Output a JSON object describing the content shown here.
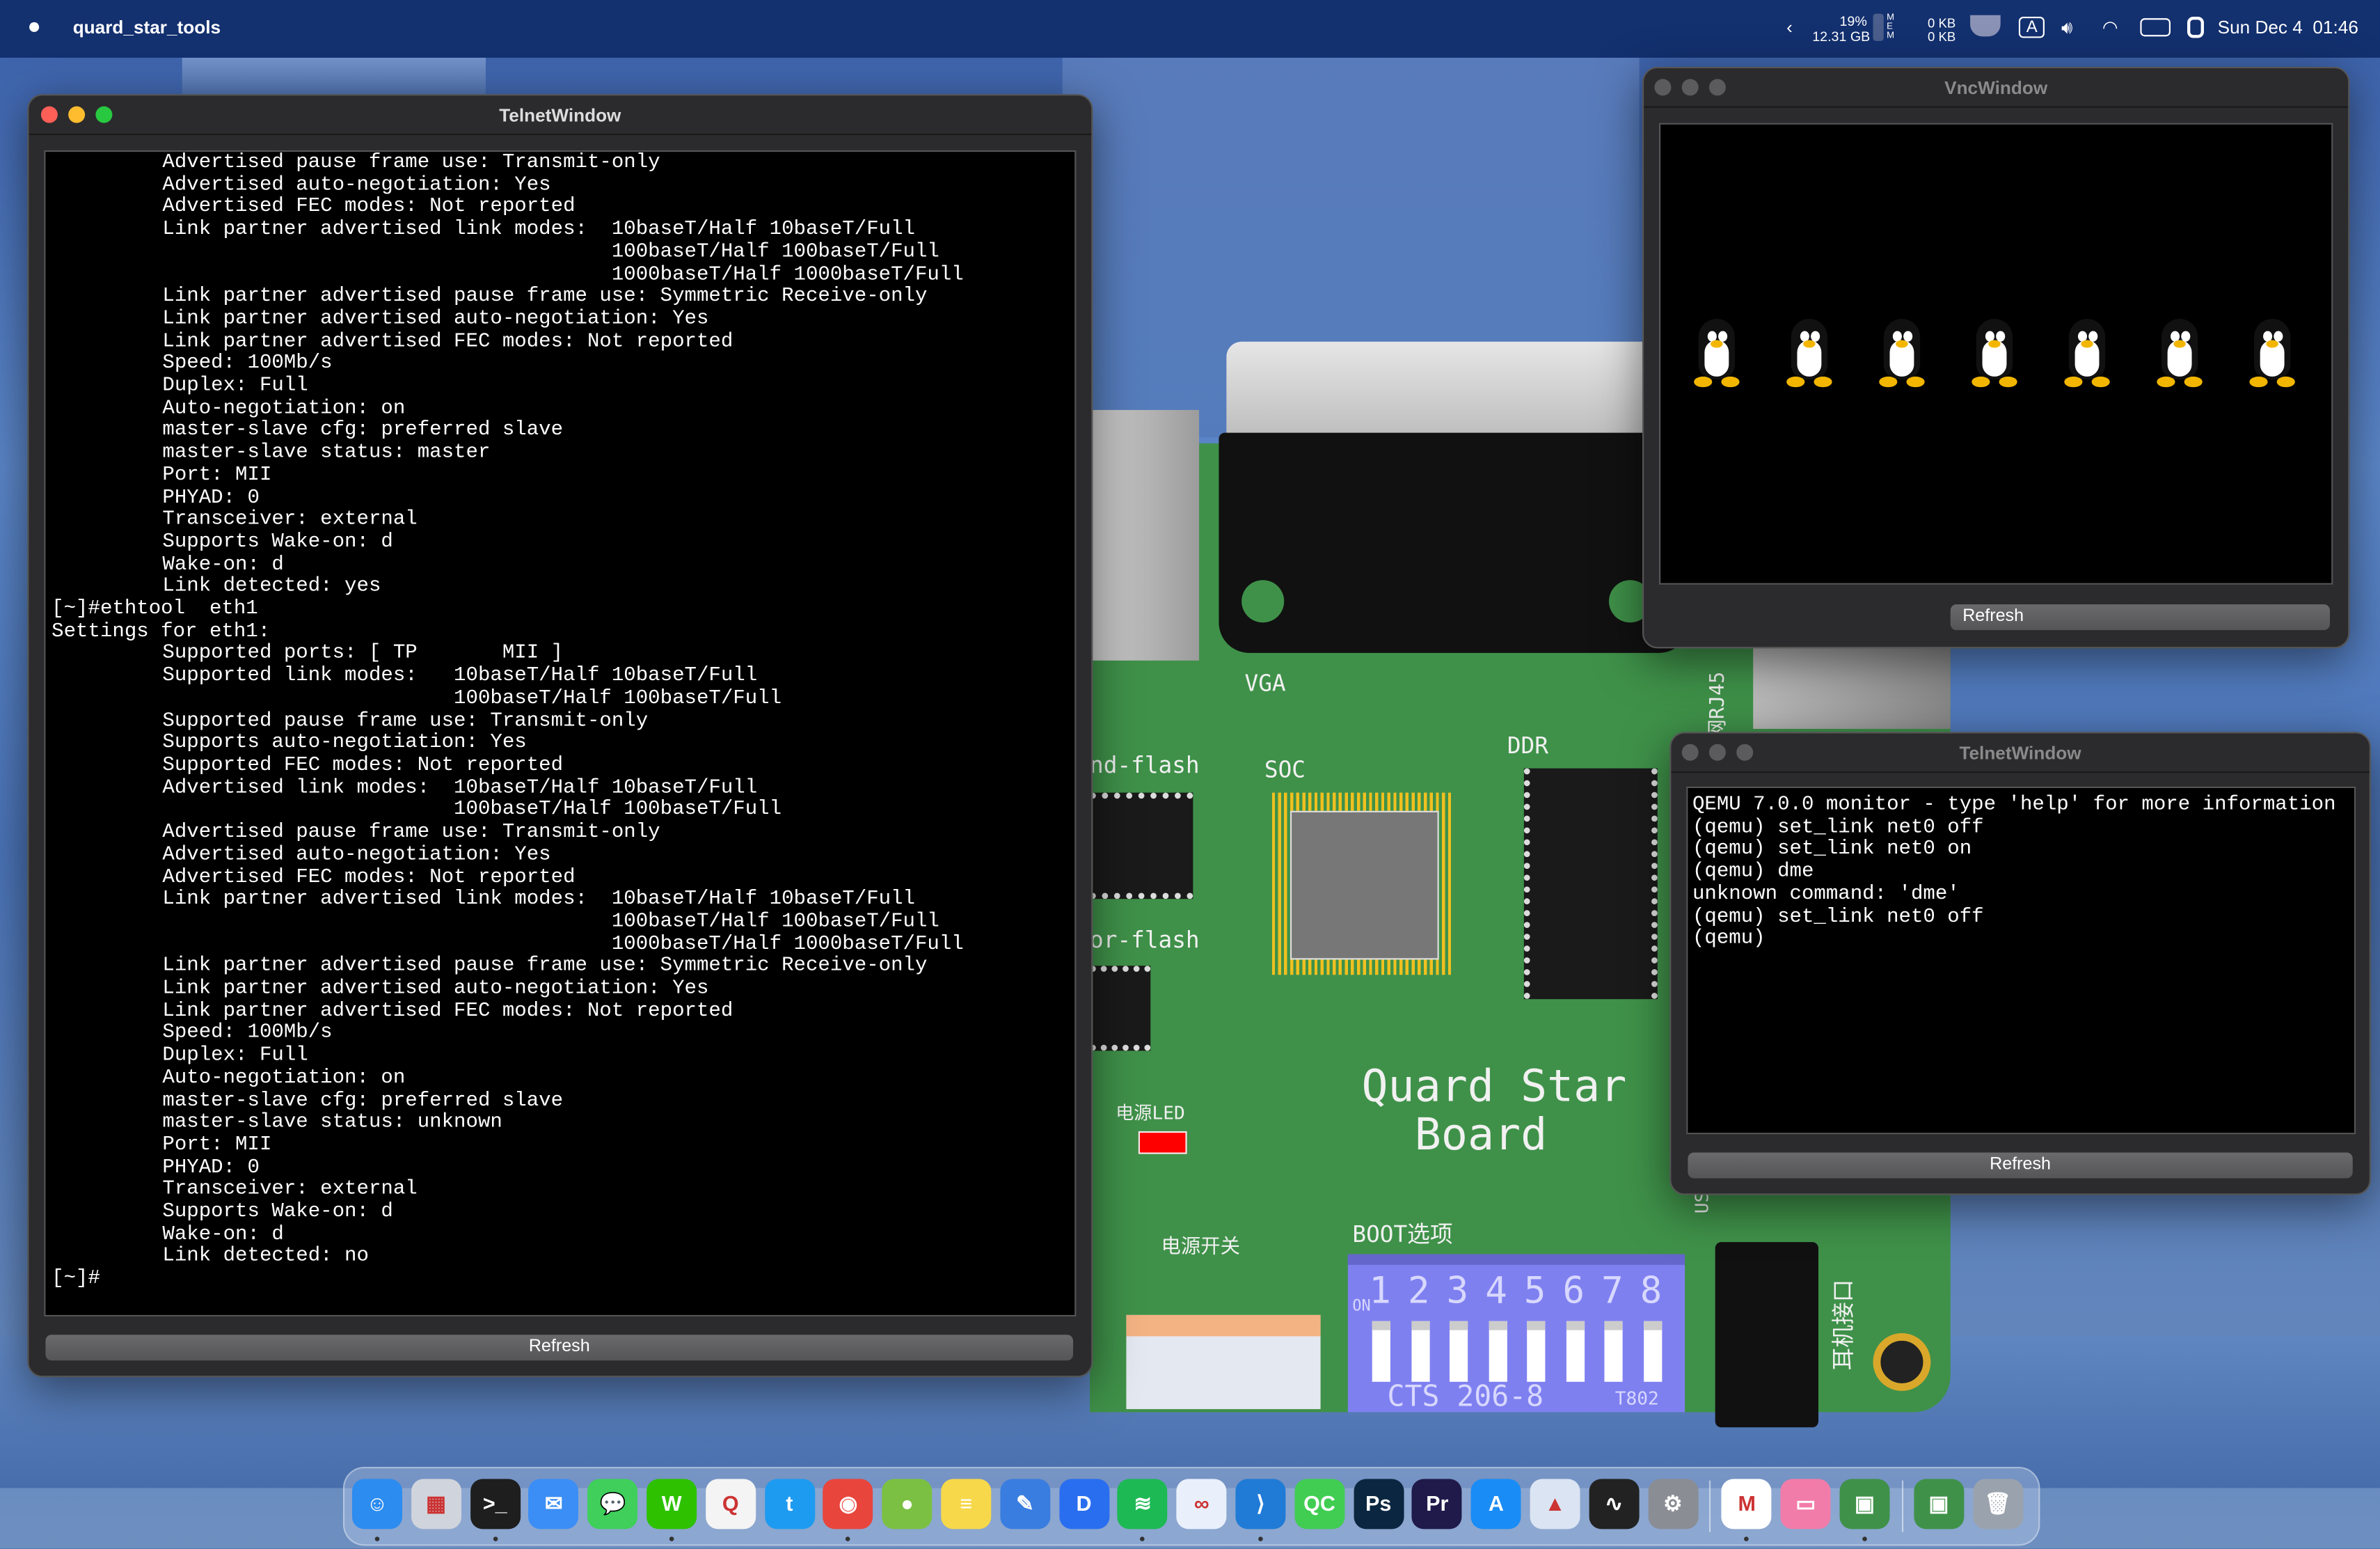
{
  "menubar": {
    "app_name": "quard_star_tools",
    "cpu_percent": "19%",
    "mem_used": "12.31 GB",
    "mem_label": "MEM",
    "net_up": "0 KB",
    "net_down": "0 KB",
    "input_source": "A",
    "datetime": "Sun Dec 4  01:46"
  },
  "left_telnet": {
    "title": "TelnetWindow",
    "refresh_label": "Refresh",
    "lines": [
      "\tAdvertised pause frame use: Transmit-only",
      "\tAdvertised auto-negotiation: Yes",
      "\tAdvertised FEC modes: Not reported",
      "\tLink partner advertised link modes:  10baseT/Half 10baseT/Full",
      "\t                                     100baseT/Half 100baseT/Full",
      "\t                                     1000baseT/Half 1000baseT/Full",
      "\tLink partner advertised pause frame use: Symmetric Receive-only",
      "\tLink partner advertised auto-negotiation: Yes",
      "\tLink partner advertised FEC modes: Not reported",
      "\tSpeed: 100Mb/s",
      "\tDuplex: Full",
      "\tAuto-negotiation: on",
      "\tmaster-slave cfg: preferred slave",
      "\tmaster-slave status: master",
      "\tPort: MII",
      "\tPHYAD: 0",
      "\tTransceiver: external",
      "\tSupports Wake-on: d",
      "\tWake-on: d",
      "\tLink detected: yes",
      "[~]#ethtool  eth1",
      "Settings for eth1:",
      "\tSupported ports: [ TP       MII ]",
      "\tSupported link modes:   10baseT/Half 10baseT/Full",
      "\t                        100baseT/Half 100baseT/Full",
      "\tSupported pause frame use: Transmit-only",
      "\tSupports auto-negotiation: Yes",
      "\tSupported FEC modes: Not reported",
      "\tAdvertised link modes:  10baseT/Half 10baseT/Full",
      "\t                        100baseT/Half 100baseT/Full",
      "\tAdvertised pause frame use: Transmit-only",
      "\tAdvertised auto-negotiation: Yes",
      "\tAdvertised FEC modes: Not reported",
      "\tLink partner advertised link modes:  10baseT/Half 10baseT/Full",
      "\t                                     100baseT/Half 100baseT/Full",
      "\t                                     1000baseT/Half 1000baseT/Full",
      "\tLink partner advertised pause frame use: Symmetric Receive-only",
      "\tLink partner advertised auto-negotiation: Yes",
      "\tLink partner advertised FEC modes: Not reported",
      "\tSpeed: 100Mb/s",
      "\tDuplex: Full",
      "\tAuto-negotiation: on",
      "\tmaster-slave cfg: preferred slave",
      "\tmaster-slave status: unknown",
      "\tPort: MII",
      "\tPHYAD: 0",
      "\tTransceiver: external",
      "\tSupports Wake-on: d",
      "\tWake-on: d",
      "\tLink detected: no",
      "[~]#"
    ]
  },
  "vnc": {
    "title": "VncWindow",
    "refresh_label": "Refresh",
    "penguin_count": 7
  },
  "right_telnet": {
    "title": "TelnetWindow",
    "refresh_label": "Refresh",
    "lines": [
      "QEMU 7.0.0 monitor - type 'help' for more information",
      "(qemu) set_link net0 off",
      "(qemu) set_link net0 on",
      "(qemu) dme",
      "unknown command: 'dme'",
      "(qemu) set_link net0 off",
      "(qemu)"
    ]
  },
  "board": {
    "vga": "VGA",
    "rj45": "网RJ45",
    "nand": "nd-flash",
    "nor": "or-flash",
    "soc": "SOC",
    "ddr": "DDR",
    "led": "电源LED",
    "title_line1": "Quard Star",
    "title_line2": "Board",
    "power_switch": "电源开关",
    "boot": "BOOT选项",
    "dip_numbers": [
      "1",
      "2",
      "3",
      "4",
      "5",
      "6",
      "7",
      "8"
    ],
    "dip_on": "ON",
    "dip_model": "CTS 206-8",
    "dip_code": "T802",
    "earphone": "耳机接口",
    "usb": "US",
    "led_color": "#ff0000",
    "pcb_color": "#3f9149",
    "dip_color": "#7f80f0"
  },
  "dock": {
    "items": [
      {
        "name": "finder",
        "label": "☺",
        "color": "#2d8cf0",
        "running": true
      },
      {
        "name": "launchpad",
        "label": "▦",
        "color": "#d0d4dc",
        "running": false
      },
      {
        "name": "terminal",
        "label": ">_",
        "color": "#1e1e1e",
        "running": true
      },
      {
        "name": "mail",
        "label": "✉",
        "color": "#3b8ef5",
        "running": false
      },
      {
        "name": "messages",
        "label": "💬",
        "color": "#3fcf5a",
        "running": false
      },
      {
        "name": "wechat",
        "label": "W",
        "color": "#2dc100",
        "running": true
      },
      {
        "name": "qq",
        "label": "Q",
        "color": "#f4f4f4",
        "running": false
      },
      {
        "name": "twitter",
        "label": "t",
        "color": "#1d9bf0",
        "running": false
      },
      {
        "name": "chrome",
        "label": "◉",
        "color": "#e8453c",
        "running": true
      },
      {
        "name": "game",
        "label": "●",
        "color": "#7bc043",
        "running": false
      },
      {
        "name": "notes",
        "label": "≡",
        "color": "#f7d84a",
        "running": false
      },
      {
        "name": "pencil",
        "label": "✎",
        "color": "#3a7de0",
        "running": false
      },
      {
        "name": "dict",
        "label": "D",
        "color": "#2a6ef0",
        "running": false
      },
      {
        "name": "spotify",
        "label": "≋",
        "color": "#1db954",
        "running": true
      },
      {
        "name": "baidu-netdisk",
        "label": "∞",
        "color": "#e9f0fb",
        "running": false
      },
      {
        "name": "vscode",
        "label": "⟩",
        "color": "#1f7bd6",
        "running": true
      },
      {
        "name": "qt-creator",
        "label": "QC",
        "color": "#41cd52",
        "running": false
      },
      {
        "name": "photoshop",
        "label": "Ps",
        "color": "#0b2640",
        "running": false
      },
      {
        "name": "premiere",
        "label": "Pr",
        "color": "#1f1a4a",
        "running": false
      },
      {
        "name": "app-store",
        "label": "A",
        "color": "#1a8cf5",
        "running": false
      },
      {
        "name": "rocket",
        "label": "▲",
        "color": "#dbe4f2",
        "running": false
      },
      {
        "name": "activity-monitor",
        "label": "∿",
        "color": "#222",
        "running": false
      },
      {
        "name": "system-preferences",
        "label": "⚙",
        "color": "#8a8d93",
        "running": false
      },
      {
        "name": "gmail",
        "label": "M",
        "color": "#ffffff",
        "running": true
      },
      {
        "name": "pink-app",
        "label": "▭",
        "color": "#f27ca9",
        "running": false
      },
      {
        "name": "quard-star-tools",
        "label": "▣",
        "color": "#3f9149",
        "running": true
      },
      {
        "name": "quard-star-board",
        "label": "▣",
        "color": "#3f9149",
        "running": false
      },
      {
        "name": "trash",
        "label": "🗑",
        "color": "#9aa3ad",
        "running": false
      }
    ]
  }
}
